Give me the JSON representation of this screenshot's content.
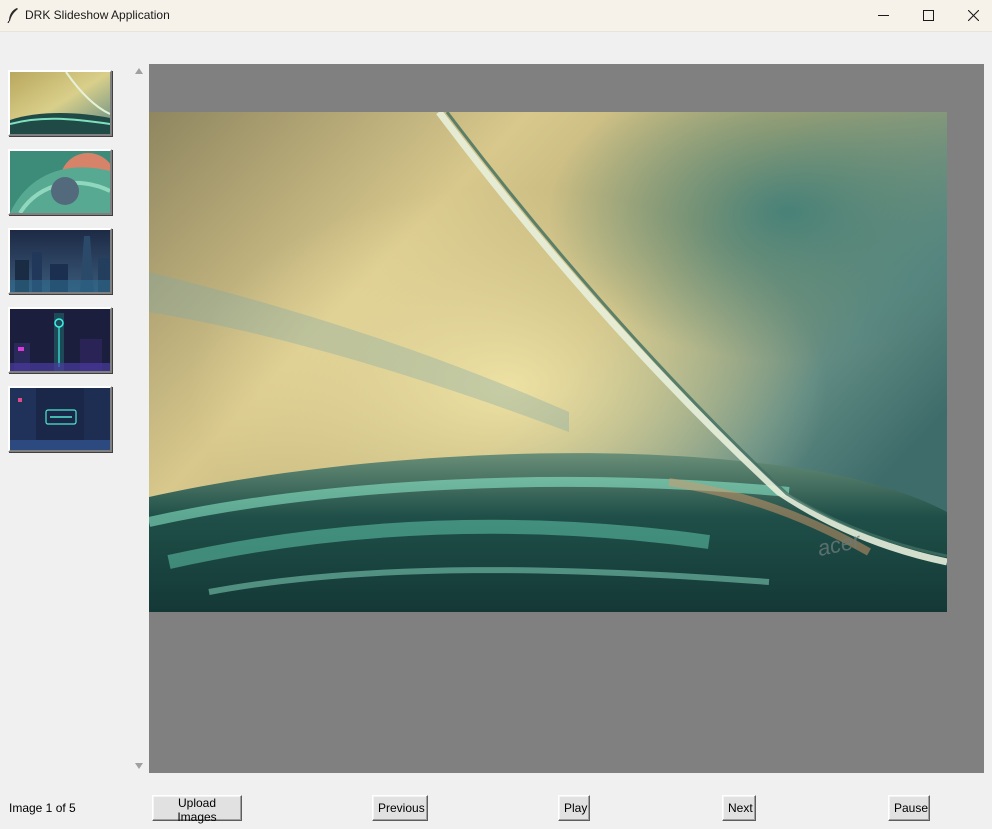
{
  "window": {
    "title": "DRK Slideshow Application",
    "icon": "feather-icon",
    "controls": [
      "minimize-icon",
      "maximize-icon",
      "close-icon"
    ]
  },
  "thumbnails": [
    {
      "index": 1,
      "subject": "abstract teal glass curve"
    },
    {
      "index": 2,
      "subject": "abstract teal and coral swirl"
    },
    {
      "index": 3,
      "subject": "night futuristic city skyline"
    },
    {
      "index": 4,
      "subject": "neon city tower"
    },
    {
      "index": 5,
      "subject": "neon alley with sign"
    }
  ],
  "viewer": {
    "background": "#808080",
    "current_image": {
      "subject": "abstract teal glass curve",
      "watermark": "acer"
    }
  },
  "status": {
    "label": "Image 1 of 5"
  },
  "controls": {
    "upload": "Upload Images",
    "previous": "Previous",
    "play": "Play",
    "next": "Next",
    "pause": "Pause"
  }
}
